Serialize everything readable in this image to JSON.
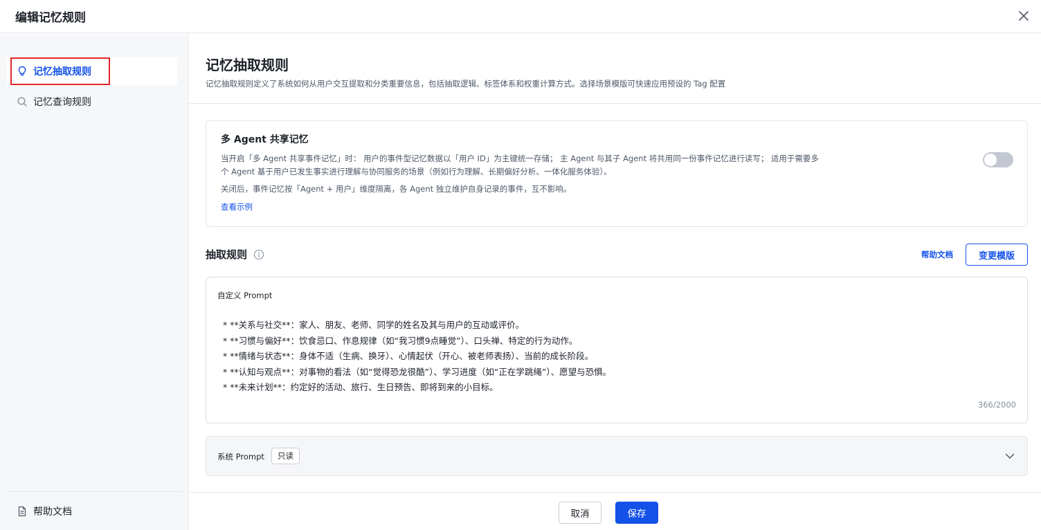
{
  "header": {
    "title": "编辑记忆规则"
  },
  "sidebar": {
    "items": [
      {
        "label": "记忆抽取规则",
        "active": true
      },
      {
        "label": "记忆查询规则",
        "active": false
      }
    ],
    "footer_label": "帮助文档"
  },
  "main": {
    "title": "记忆抽取规则",
    "description": "记忆抽取规则定义了系统如何从用户交互提取和分类重要信息，包括抽取逻辑、标签体系和权重计算方式。选择场景模版可快速应用预设的 Tag 配置",
    "share_card": {
      "title": "多 Agent 共享记忆",
      "description": "当开启「多 Agent 共享事件记忆」时：  用户的事件型记忆数据以「用户 ID」为主键统一存储；  主 Agent 与其子 Agent 将共用同一份事件记忆进行读写；  适用于需要多个 Agent 基于用户已发生事实进行理解与协同服务的场景（例如行为理解、长期偏好分析、一体化服务体验）。",
      "description_off": "关闭后，事件记忆按「Agent + 用户」维度隔离，各 Agent 独立维护自身记录的事件，互不影响。",
      "link_label": "查看示例",
      "toggle_on": false
    },
    "rules": {
      "title": "抽取规则",
      "help_link": "帮助文档",
      "change_template_label": "变更模版"
    },
    "custom_prompt": {
      "label": "自定义 Prompt",
      "value": "  * **关系与社交**：家人、朋友、老师、同学的姓名及其与用户的互动或评价。\n  * **习惯与偏好**：饮食忌口、作息规律（如“我习惯9点睡觉”）、口头禅、特定的行为动作。\n  * **情绪与状态**：身体不适（生病、换牙）、心情起伏（开心、被老师表扬）、当前的成长阶段。\n  * **认知与观点**：对事物的看法（如“觉得恐龙很酷”）、学习进度（如“正在学跳绳”）、愿望与恐惧。\n  * **未来计划**：约定好的活动、旅行、生日预告、即将到来的小目标。",
      "count": "366/2000"
    },
    "system_prompt": {
      "label": "系统 Prompt",
      "tag": "只读"
    }
  },
  "footer": {
    "cancel_label": "取消",
    "save_label": "保存"
  },
  "colors": {
    "accent": "#1451e8",
    "highlight_border": "#e02424",
    "sidebar_bg": "#f6f7f9"
  }
}
